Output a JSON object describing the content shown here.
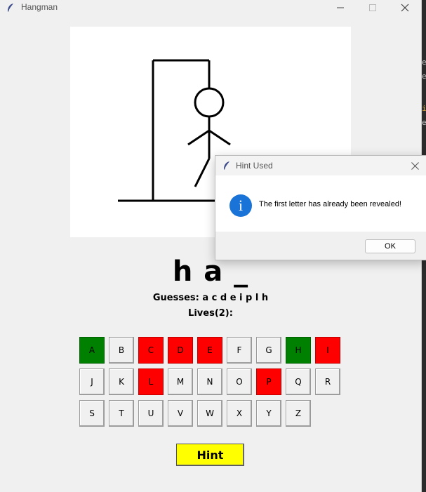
{
  "window": {
    "title": "Hangman",
    "icon": "feather-icon"
  },
  "game": {
    "word_display": "h a _",
    "guesses_text": "Guesses: a c d e i p l h",
    "lives_text": "Lives(2):",
    "hint_label": "Hint",
    "colors": {
      "correct": "#008000",
      "wrong": "#ff0000",
      "hint": "#ffff00"
    }
  },
  "keyboard": {
    "keys": [
      {
        "letter": "A",
        "state": "correct"
      },
      {
        "letter": "B",
        "state": "unused"
      },
      {
        "letter": "C",
        "state": "wrong"
      },
      {
        "letter": "D",
        "state": "wrong"
      },
      {
        "letter": "E",
        "state": "wrong"
      },
      {
        "letter": "F",
        "state": "unused"
      },
      {
        "letter": "G",
        "state": "unused"
      },
      {
        "letter": "H",
        "state": "correct"
      },
      {
        "letter": "I",
        "state": "wrong"
      },
      {
        "letter": "J",
        "state": "unused"
      },
      {
        "letter": "K",
        "state": "unused"
      },
      {
        "letter": "L",
        "state": "wrong"
      },
      {
        "letter": "M",
        "state": "unused"
      },
      {
        "letter": "N",
        "state": "unused"
      },
      {
        "letter": "O",
        "state": "unused"
      },
      {
        "letter": "P",
        "state": "wrong"
      },
      {
        "letter": "Q",
        "state": "unused"
      },
      {
        "letter": "R",
        "state": "unused"
      },
      {
        "letter": "S",
        "state": "unused"
      },
      {
        "letter": "T",
        "state": "unused"
      },
      {
        "letter": "U",
        "state": "unused"
      },
      {
        "letter": "V",
        "state": "unused"
      },
      {
        "letter": "W",
        "state": "unused"
      },
      {
        "letter": "X",
        "state": "unused"
      },
      {
        "letter": "Y",
        "state": "unused"
      },
      {
        "letter": "Z",
        "state": "unused"
      }
    ]
  },
  "dialog": {
    "title": "Hint Used",
    "message": "The first letter has already been revealed!",
    "ok_label": "OK",
    "icon": "info-icon",
    "icon_glyph": "i"
  },
  "background_editor": {
    "glyphs": [
      "e",
      "e",
      "i",
      "e"
    ]
  }
}
